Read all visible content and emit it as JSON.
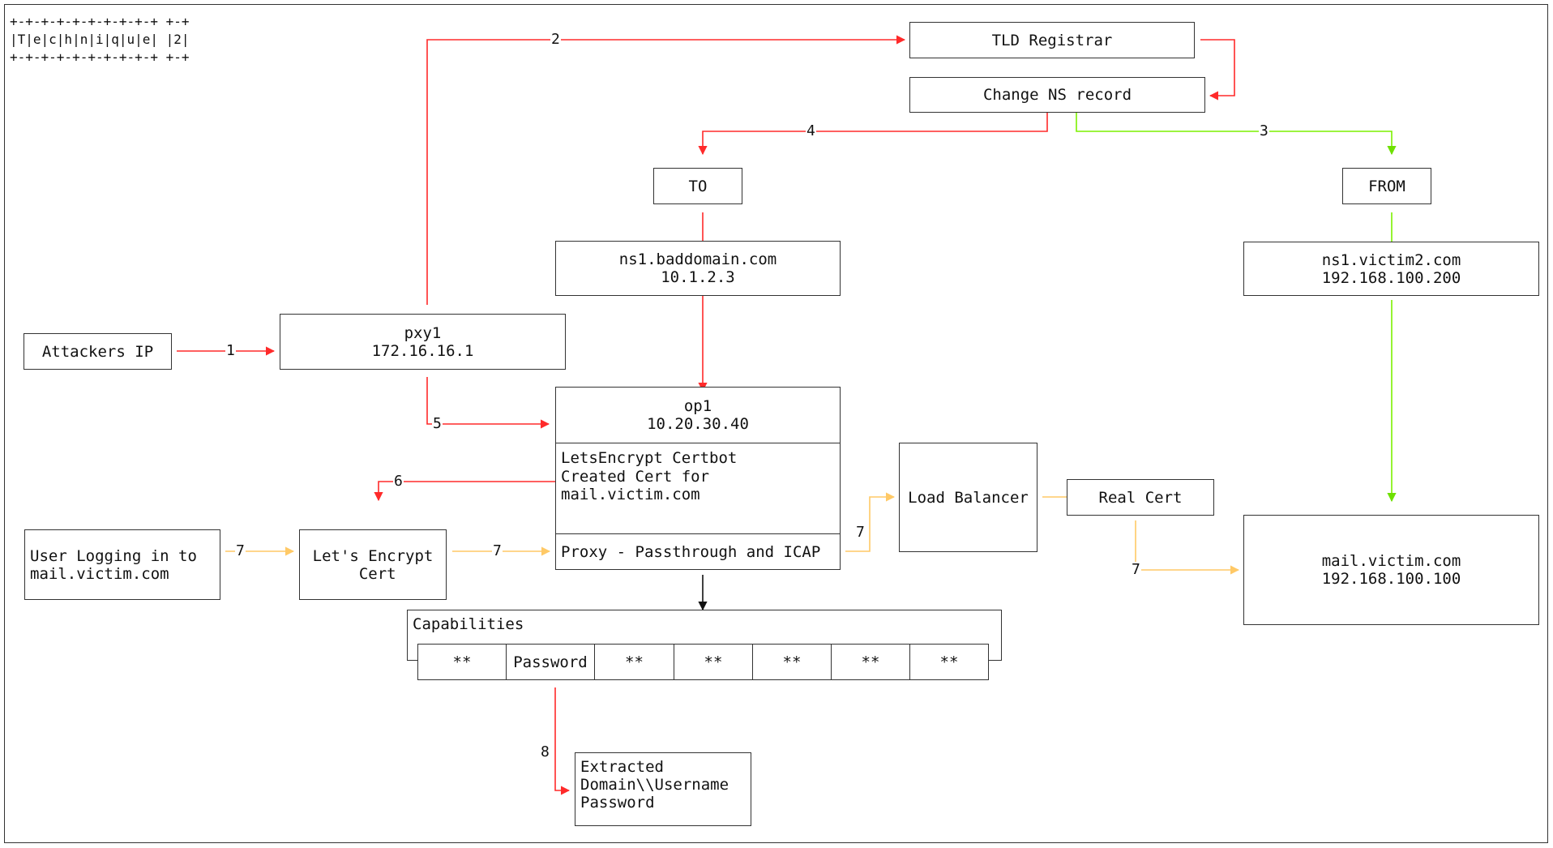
{
  "header": {
    "ascii_banner": "+-+-+-+-+-+-+-+-+-+ +-+\n|T|e|c|h|n|i|q|u|e| |2|\n+-+-+-+-+-+-+-+-+-+ +-+"
  },
  "colors": {
    "attack": "#ff2a2a",
    "legit": "#7cf000",
    "user_traffic": "#ffd27f",
    "box_border": "#333333"
  },
  "nodes": {
    "attackers_ip": "Attackers IP",
    "pxy1": "pxy1\n172.16.16.1",
    "tld_registrar": "TLD Registrar",
    "change_ns": "Change NS record",
    "to": "TO",
    "from": "FROM",
    "ns_bad": "ns1.baddomain.com\n10.1.2.3",
    "ns_victim": "ns1.victim2.com\n192.168.100.200",
    "op1_header": "op1\n10.20.30.40",
    "op1_certbot": "LetsEncrypt Certbot\nCreated Cert for\nmail.victim.com",
    "op1_proxy": "Proxy - Passthrough and ICAP",
    "user": "User Logging in to\nmail.victim.com",
    "le_cert": "Let's Encrypt\n Cert",
    "load_balancer": "Load Balancer",
    "real_cert": "Real Cert",
    "mail_server": "mail.victim.com\n192.168.100.100",
    "extracted": "Extracted\nDomain\\\\Username\nPassword"
  },
  "capabilities": {
    "title": "Capabilities",
    "cells": [
      "**",
      "Password",
      "**",
      "**",
      "**",
      "**",
      "**"
    ]
  },
  "edge_labels": {
    "e1": "1",
    "e2": "2",
    "e3": "3",
    "e4": "4",
    "e5": "5",
    "e6": "6",
    "e7a": "7",
    "e7b": "7",
    "e7c": "7",
    "e7d": "7",
    "e8": "8"
  }
}
